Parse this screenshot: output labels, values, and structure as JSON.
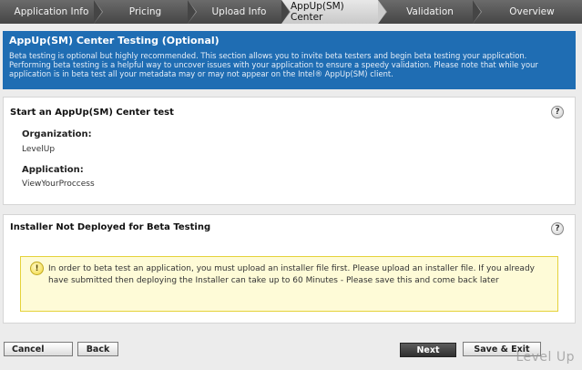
{
  "steps": [
    {
      "label": "Application Info",
      "active": false
    },
    {
      "label": "Pricing",
      "active": false
    },
    {
      "label": "Upload Info",
      "active": false
    },
    {
      "label": "AppUp(SM) Center",
      "active": true
    },
    {
      "label": "Validation",
      "active": false
    },
    {
      "label": "Overview",
      "active": false
    }
  ],
  "banner": {
    "title": "AppUp(SM) Center Testing (Optional)",
    "description": "Beta testing is optional but highly recommended. This section allows you to invite beta testers and begin beta testing your application. Performing beta testing is a helpful way to uncover issues with your application to ensure a speedy validation. Please note that while your application is in beta test all your metadata may or may not appear on the Intel® AppUp(SM) client."
  },
  "start_test": {
    "title": "Start an AppUp(SM) Center test",
    "help": "?",
    "organization_label": "Organization:",
    "organization_value": "LevelUp",
    "application_label": "Application:",
    "application_value": "ViewYourProccess"
  },
  "installer": {
    "title": "Installer Not Deployed for Beta Testing",
    "help": "?",
    "notice_icon": "!",
    "notice": "In order to beta test an application, you must upload an installer file first. Please upload an installer file. If you already have submitted then deploying the Installer can take up to 60 Minutes - Please save this and come back later"
  },
  "buttons": {
    "cancel": "Cancel",
    "back": "Back",
    "next": "Next",
    "save_exit": "Save & Exit"
  },
  "watermark": "Level Up"
}
